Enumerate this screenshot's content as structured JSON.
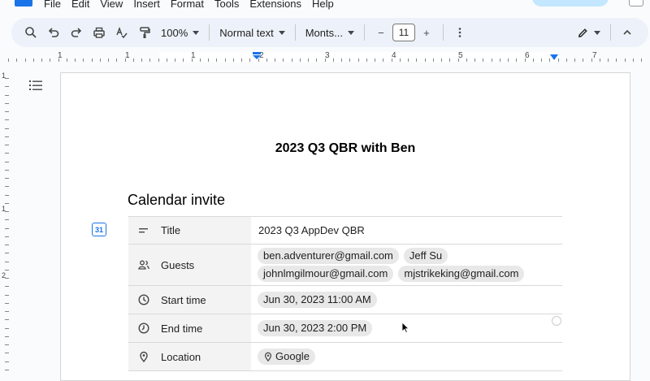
{
  "menu": [
    "File",
    "Edit",
    "View",
    "Insert",
    "Format",
    "Tools",
    "Extensions",
    "Help"
  ],
  "toolbar": {
    "zoom": "100%",
    "style": "Normal text",
    "font": "Monts...",
    "font_size": "11",
    "minus": "−",
    "plus": "+"
  },
  "ruler": {
    "numbers": [
      {
        "label": "1"
      },
      {
        "label": "1"
      },
      {
        "label": "1"
      },
      {
        "label": "2"
      },
      {
        "label": "3"
      },
      {
        "label": "4"
      },
      {
        "label": "5"
      },
      {
        "label": "6"
      },
      {
        "label": "7"
      }
    ],
    "left_numbers": [
      "1",
      "1",
      "2"
    ]
  },
  "document": {
    "title": "2023 Q3 QBR with Ben",
    "section_heading": "Calendar invite",
    "calendar_chip": "31",
    "rows": [
      {
        "icon": "title-icon",
        "label": "Title",
        "values": [
          "2023 Q3 AppDev QBR"
        ],
        "chips": false
      },
      {
        "icon": "guests-icon",
        "label": "Guests",
        "values": [
          "ben.adventurer@gmail.com",
          "Jeff Su",
          "johnlmgilmour@gmail.com",
          "mjstrikeking@gmail.com"
        ],
        "chips": true
      },
      {
        "icon": "clock-icon",
        "label": "Start time",
        "values": [
          "Jun 30, 2023 11:00 AM"
        ],
        "chips": true
      },
      {
        "icon": "clock-icon",
        "label": "End time",
        "values": [
          "Jun 30, 2023 2:00 PM"
        ],
        "chips": true
      },
      {
        "icon": "location-icon",
        "label": "Location",
        "values": [
          "Google"
        ],
        "chips": true
      }
    ]
  },
  "colors": {
    "accent": "#1a73e8",
    "toolbar_bg": "#edf2fa",
    "chip_bg": "#e8e8e8",
    "label_bg": "#f3f3f3"
  }
}
